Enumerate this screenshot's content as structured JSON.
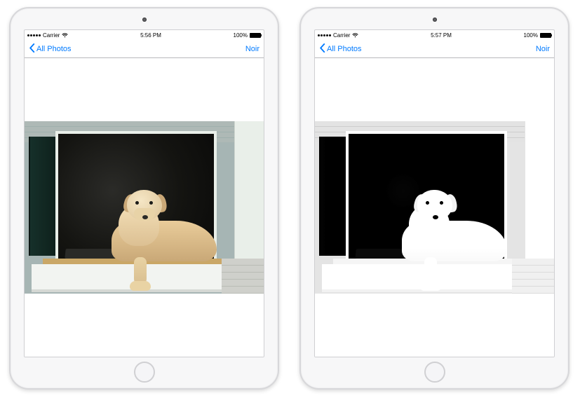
{
  "devices": [
    {
      "status": {
        "carrier": "Carrier",
        "time": "5:56 PM",
        "battery": "100%"
      },
      "navbar": {
        "back_label": "All Photos",
        "action_label": "Noir"
      },
      "photo_variant": "color"
    },
    {
      "status": {
        "carrier": "Carrier",
        "time": "5:57 PM",
        "battery": "100%"
      },
      "navbar": {
        "back_label": "All Photos",
        "action_label": "Noir"
      },
      "photo_variant": "noir"
    }
  ],
  "colors": {
    "accent": "#007aff"
  }
}
